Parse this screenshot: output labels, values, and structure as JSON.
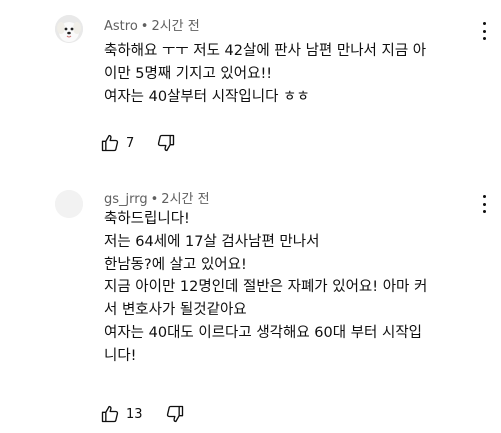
{
  "comments": [
    {
      "author": "Astro",
      "separator": "•",
      "time": "2시간 전",
      "avatar_icon": "white-dog-avatar",
      "lines": [
        "축하해요 ㅜㅜ 저도  42살에 판사 남편 만나서 지금 아",
        "이만 5명째 기지고 있어요!!",
        "여자는 40살부터 시작입니다 ㅎㅎ"
      ],
      "like_count": "7"
    },
    {
      "author": "gs_jrrg",
      "separator": "•",
      "time": "2시간 전",
      "avatar_icon": "blank-avatar",
      "lines": [
        "축하드립니다!",
        "저는 64세에 17살 검사남편 만나서",
        "한남동?에 살고 있어요!",
        "지금 아이만 12명인데 절반은 자폐가 있어요! 아마 커",
        "서 변호사가 될것같아요",
        "여자는 40대도 이르다고 생각해요 60대 부터 시작입",
        "니다!"
      ],
      "like_count": "13"
    }
  ]
}
